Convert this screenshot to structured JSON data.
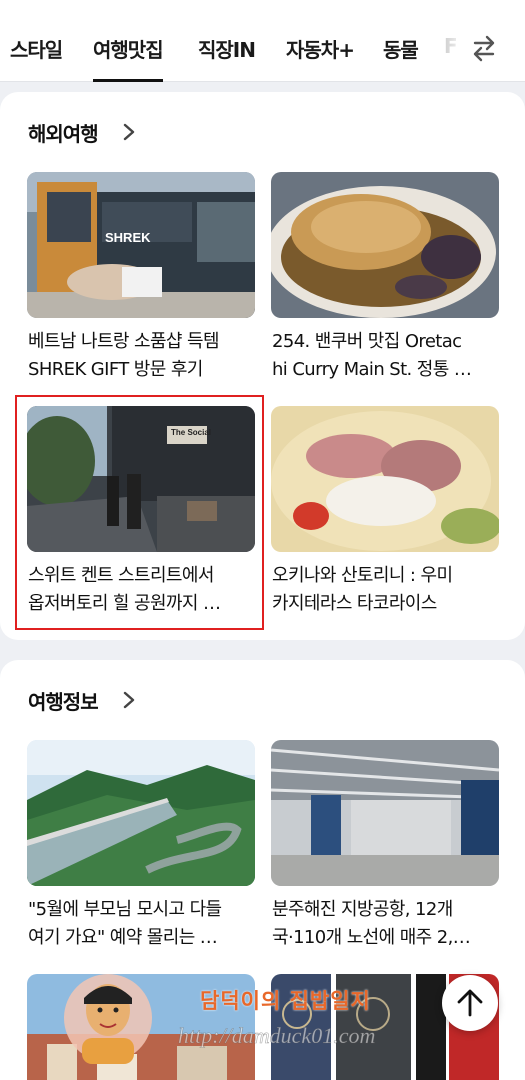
{
  "tabs": [
    "스타일",
    "여행맛집",
    "직장IN",
    "자동차+",
    "동물",
    "F"
  ],
  "active_tab": 1,
  "icons": {
    "swap": "swap-arrows-icon",
    "chevron": "chevron-right-icon",
    "up": "arrow-up-icon"
  },
  "sections": [
    {
      "title": "해외여행",
      "items": [
        {
          "line1": "베트남 나트랑 소품샵 득템",
          "line2": "SHREK GIFT 방문 후기",
          "thumb_sign": "SHREK"
        },
        {
          "line1": "254. 밴쿠버 맛집 Oretac",
          "line2": "hi Curry Main St. 정통 …"
        },
        {
          "line1": "스위트 켄트 스트리트에서",
          "line2": "옵저버토리 힐 공원까지 …",
          "thumb_sign": "The Social"
        },
        {
          "line1": "오키나와 산토리니 : 우미",
          "line2": "카지테라스 타코라이스"
        }
      ]
    },
    {
      "title": "여행정보",
      "items": [
        {
          "line1": "\"5월에 부모님 모시고 다들",
          "line2": "여기 가요\" 예약 몰리는 …"
        },
        {
          "line1": "분주해진 지방공항, 12개",
          "line2": "국·110개 노선에 매주 2,…"
        },
        {
          "line1": "",
          "line2": ""
        },
        {
          "line1": "",
          "line2": ""
        }
      ]
    }
  ],
  "watermark": {
    "name": "담덕이의 집밥일지",
    "url": "http://damduck01.com"
  },
  "colors": {
    "highlight": "#e02020",
    "watermark_name": "#e8682a"
  }
}
